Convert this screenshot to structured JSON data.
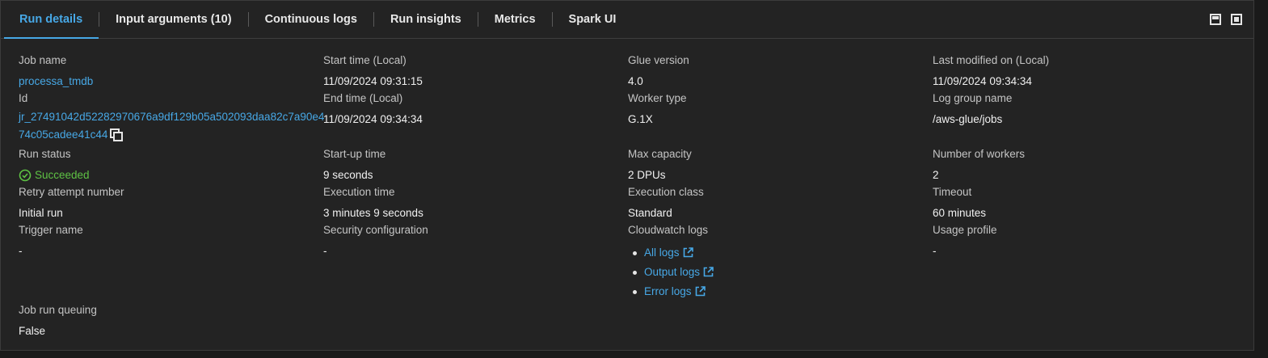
{
  "tabs": [
    {
      "label": "Run details"
    },
    {
      "label": "Input arguments (10)"
    },
    {
      "label": "Continuous logs"
    },
    {
      "label": "Run insights"
    },
    {
      "label": "Metrics"
    },
    {
      "label": "Spark UI"
    }
  ],
  "active_tab": "Run details",
  "colors": {
    "accent": "#47a8e6",
    "success": "#5ec244",
    "background": "#232323"
  },
  "fields": {
    "job_name": {
      "label": "Job name",
      "value": "processa_tmdb"
    },
    "id": {
      "label": "Id",
      "value": "jr_27491042d52282970676a9df129b05a502093daa82c7a90e474c05cadee41c44"
    },
    "run_status": {
      "label": "Run status",
      "value": "Succeeded"
    },
    "retry_attempt": {
      "label": "Retry attempt number",
      "value": "Initial run"
    },
    "trigger_name": {
      "label": "Trigger name",
      "value": "-"
    },
    "job_run_queuing": {
      "label": "Job run queuing",
      "value": "False"
    },
    "start_time": {
      "label": "Start time (Local)",
      "value": "11/09/2024 09:31:15"
    },
    "end_time": {
      "label": "End time (Local)",
      "value": "11/09/2024 09:34:34"
    },
    "startup_time": {
      "label": "Start-up time",
      "value": "9 seconds"
    },
    "execution_time": {
      "label": "Execution time",
      "value": "3 minutes 9 seconds"
    },
    "security_configuration": {
      "label": "Security configuration",
      "value": "-"
    },
    "glue_version": {
      "label": "Glue version",
      "value": "4.0"
    },
    "worker_type": {
      "label": "Worker type",
      "value": "G.1X"
    },
    "max_capacity": {
      "label": "Max capacity",
      "value": "2 DPUs"
    },
    "execution_class": {
      "label": "Execution class",
      "value": "Standard"
    },
    "cloudwatch_logs": {
      "label": "Cloudwatch logs",
      "links": [
        "All logs",
        "Output logs",
        "Error logs"
      ]
    },
    "last_modified": {
      "label": "Last modified on (Local)",
      "value": "11/09/2024 09:34:34"
    },
    "log_group_name": {
      "label": "Log group name",
      "value": "/aws-glue/jobs"
    },
    "number_of_workers": {
      "label": "Number of workers",
      "value": "2"
    },
    "timeout": {
      "label": "Timeout",
      "value": "60 minutes"
    },
    "usage_profile": {
      "label": "Usage profile",
      "value": "-"
    }
  },
  "icons": {
    "copy": "copy-icon",
    "status": "check-circle-icon",
    "external": "external-link-icon",
    "minimize": "minimize-icon",
    "maximize": "maximize-icon"
  }
}
